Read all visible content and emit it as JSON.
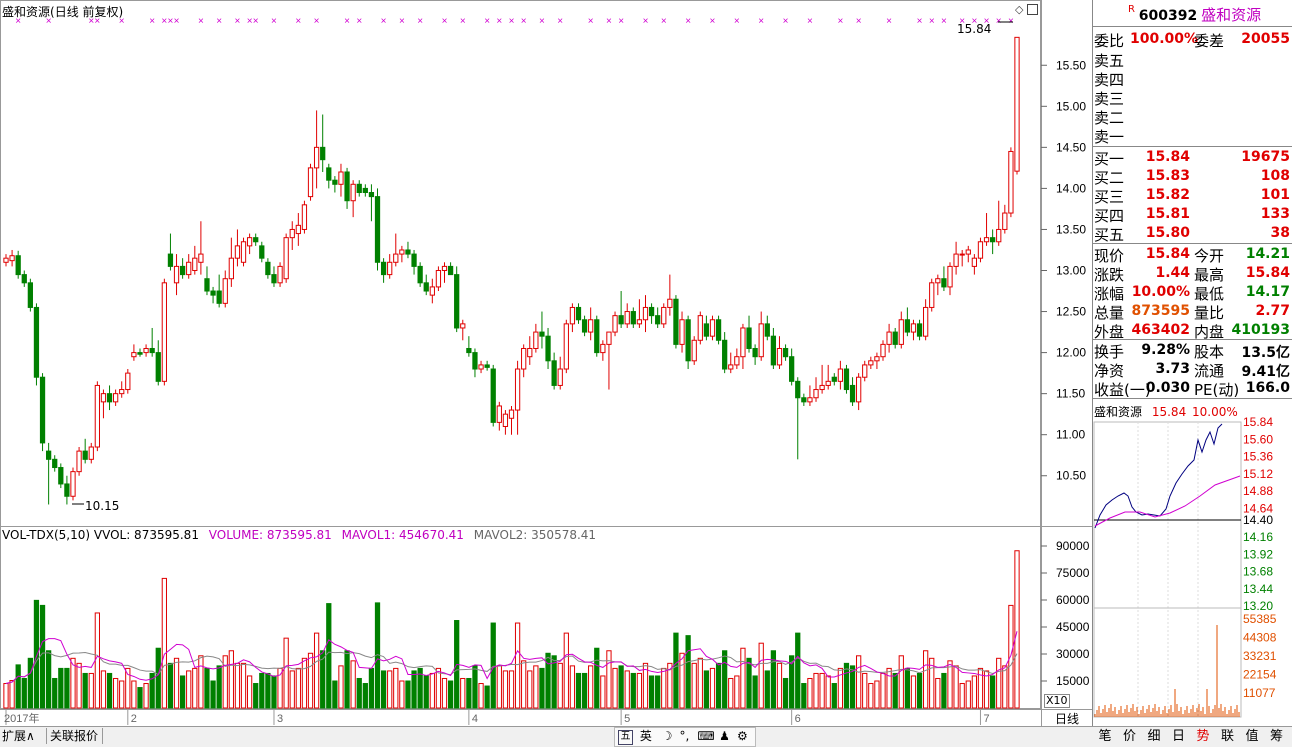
{
  "header": {
    "stock_name": "盛和资源",
    "period": "(日线 前复权)"
  },
  "chart_data": {
    "type": "candlestick",
    "ylim": [
      9.9,
      16.1
    ],
    "y_ticks": [
      "15.50",
      "15.00",
      "14.50",
      "14.00",
      "13.50",
      "13.00",
      "12.50",
      "12.00",
      "11.50",
      "11.00",
      "10.50"
    ],
    "high_label": "15.84",
    "low_label": "10.15",
    "months": [
      {
        "label": "2017年",
        "index": 0
      },
      {
        "label": "2",
        "index": 20
      },
      {
        "label": "3",
        "index": 44
      },
      {
        "label": "4",
        "index": 76
      },
      {
        "label": "5",
        "index": 101
      },
      {
        "label": "6",
        "index": 129
      },
      {
        "label": "7",
        "index": 160
      }
    ],
    "candles": [
      {
        "o": 13.1,
        "h": 13.2,
        "l": 13.05,
        "c": 13.15
      },
      {
        "o": 13.12,
        "h": 13.25,
        "l": 13.05,
        "c": 13.18
      },
      {
        "o": 13.18,
        "h": 13.24,
        "l": 12.9,
        "c": 12.95
      },
      {
        "o": 12.95,
        "h": 13.0,
        "l": 12.8,
        "c": 12.85
      },
      {
        "o": 12.85,
        "h": 12.9,
        "l": 12.5,
        "c": 12.55
      },
      {
        "o": 12.55,
        "h": 12.6,
        "l": 11.6,
        "c": 11.7
      },
      {
        "o": 11.7,
        "h": 11.75,
        "l": 10.8,
        "c": 10.9
      },
      {
        "o": 10.8,
        "h": 10.9,
        "l": 10.15,
        "c": 10.7
      },
      {
        "o": 10.7,
        "h": 10.75,
        "l": 10.55,
        "c": 10.6
      },
      {
        "o": 10.6,
        "h": 10.65,
        "l": 10.35,
        "c": 10.4
      },
      {
        "o": 10.4,
        "h": 10.5,
        "l": 10.15,
        "c": 10.25
      },
      {
        "o": 10.25,
        "h": 10.6,
        "l": 10.2,
        "c": 10.55
      },
      {
        "o": 10.55,
        "h": 10.85,
        "l": 10.5,
        "c": 10.8
      },
      {
        "o": 10.8,
        "h": 10.95,
        "l": 10.65,
        "c": 10.7
      },
      {
        "o": 10.7,
        "h": 10.9,
        "l": 10.65,
        "c": 10.85
      },
      {
        "o": 10.85,
        "h": 11.65,
        "l": 10.8,
        "c": 11.6
      },
      {
        "o": 11.4,
        "h": 11.55,
        "l": 11.2,
        "c": 11.5
      },
      {
        "o": 11.5,
        "h": 11.6,
        "l": 11.3,
        "c": 11.4
      },
      {
        "o": 11.4,
        "h": 11.55,
        "l": 11.35,
        "c": 11.5
      },
      {
        "o": 11.5,
        "h": 11.65,
        "l": 11.45,
        "c": 11.55
      },
      {
        "o": 11.55,
        "h": 11.8,
        "l": 11.5,
        "c": 11.75
      },
      {
        "o": 11.95,
        "h": 12.1,
        "l": 11.9,
        "c": 12.0
      },
      {
        "o": 12.0,
        "h": 12.05,
        "l": 11.95,
        "c": 11.98
      },
      {
        "o": 12.0,
        "h": 12.1,
        "l": 11.95,
        "c": 12.05
      },
      {
        "o": 12.05,
        "h": 12.3,
        "l": 11.95,
        "c": 12.0
      },
      {
        "o": 12.0,
        "h": 12.15,
        "l": 11.6,
        "c": 11.65
      },
      {
        "o": 11.65,
        "h": 12.9,
        "l": 11.6,
        "c": 12.85
      },
      {
        "o": 13.2,
        "h": 13.45,
        "l": 13.0,
        "c": 13.05
      },
      {
        "o": 12.85,
        "h": 13.2,
        "l": 12.7,
        "c": 13.05
      },
      {
        "o": 13.05,
        "h": 13.15,
        "l": 12.9,
        "c": 12.95
      },
      {
        "o": 12.95,
        "h": 13.2,
        "l": 12.9,
        "c": 13.1
      },
      {
        "o": 13.0,
        "h": 13.3,
        "l": 12.95,
        "c": 13.15
      },
      {
        "o": 13.1,
        "h": 13.6,
        "l": 12.95,
        "c": 13.2
      },
      {
        "o": 12.9,
        "h": 13.05,
        "l": 12.7,
        "c": 12.75
      },
      {
        "o": 12.75,
        "h": 12.8,
        "l": 12.6,
        "c": 12.7
      },
      {
        "o": 12.75,
        "h": 12.95,
        "l": 12.55,
        "c": 12.6
      },
      {
        "o": 12.6,
        "h": 13.0,
        "l": 12.55,
        "c": 12.9
      },
      {
        "o": 12.9,
        "h": 13.4,
        "l": 12.8,
        "c": 13.15
      },
      {
        "o": 13.15,
        "h": 13.5,
        "l": 13.05,
        "c": 13.3
      },
      {
        "o": 13.1,
        "h": 13.4,
        "l": 13.05,
        "c": 13.35
      },
      {
        "o": 13.3,
        "h": 13.45,
        "l": 13.2,
        "c": 13.4
      },
      {
        "o": 13.4,
        "h": 13.45,
        "l": 13.3,
        "c": 13.35
      },
      {
        "o": 13.3,
        "h": 13.35,
        "l": 13.1,
        "c": 13.15
      },
      {
        "o": 13.1,
        "h": 13.15,
        "l": 12.9,
        "c": 12.95
      },
      {
        "o": 12.95,
        "h": 13.05,
        "l": 12.8,
        "c": 12.85
      },
      {
        "o": 12.85,
        "h": 13.1,
        "l": 12.8,
        "c": 13.05
      },
      {
        "o": 12.9,
        "h": 13.45,
        "l": 12.85,
        "c": 13.4
      },
      {
        "o": 13.4,
        "h": 13.6,
        "l": 13.25,
        "c": 13.5
      },
      {
        "o": 13.45,
        "h": 13.7,
        "l": 13.3,
        "c": 13.55
      },
      {
        "o": 13.5,
        "h": 13.85,
        "l": 13.45,
        "c": 13.8
      },
      {
        "o": 13.9,
        "h": 14.3,
        "l": 13.85,
        "c": 14.25
      },
      {
        "o": 14.25,
        "h": 14.95,
        "l": 14.0,
        "c": 14.5
      },
      {
        "o": 14.5,
        "h": 14.9,
        "l": 14.2,
        "c": 14.35
      },
      {
        "o": 14.25,
        "h": 14.3,
        "l": 14.0,
        "c": 14.1
      },
      {
        "o": 14.1,
        "h": 14.15,
        "l": 13.95,
        "c": 14.05
      },
      {
        "o": 14.05,
        "h": 14.3,
        "l": 13.9,
        "c": 14.2
      },
      {
        "o": 14.2,
        "h": 14.25,
        "l": 13.75,
        "c": 13.85
      },
      {
        "o": 13.85,
        "h": 14.1,
        "l": 13.65,
        "c": 14.05
      },
      {
        "o": 14.05,
        "h": 14.1,
        "l": 13.9,
        "c": 13.95
      },
      {
        "o": 14.0,
        "h": 14.05,
        "l": 13.9,
        "c": 13.95
      },
      {
        "o": 13.95,
        "h": 14.05,
        "l": 13.6,
        "c": 13.9
      },
      {
        "o": 13.9,
        "h": 14.0,
        "l": 13.0,
        "c": 13.1
      },
      {
        "o": 13.1,
        "h": 13.15,
        "l": 12.85,
        "c": 12.95
      },
      {
        "o": 12.95,
        "h": 13.2,
        "l": 12.9,
        "c": 13.1
      },
      {
        "o": 13.1,
        "h": 13.45,
        "l": 13.05,
        "c": 13.2
      },
      {
        "o": 13.2,
        "h": 13.3,
        "l": 13.1,
        "c": 13.25
      },
      {
        "o": 13.25,
        "h": 13.35,
        "l": 13.15,
        "c": 13.2
      },
      {
        "o": 13.2,
        "h": 13.25,
        "l": 12.95,
        "c": 13.05
      },
      {
        "o": 13.05,
        "h": 13.1,
        "l": 12.8,
        "c": 12.85
      },
      {
        "o": 12.85,
        "h": 12.95,
        "l": 12.7,
        "c": 12.75
      },
      {
        "o": 12.7,
        "h": 12.9,
        "l": 12.6,
        "c": 12.8
      },
      {
        "o": 12.8,
        "h": 13.05,
        "l": 12.75,
        "c": 13.0
      },
      {
        "o": 13.0,
        "h": 13.1,
        "l": 12.85,
        "c": 13.05
      },
      {
        "o": 13.05,
        "h": 13.1,
        "l": 12.95,
        "c": 12.95
      },
      {
        "o": 12.95,
        "h": 13.05,
        "l": 12.25,
        "c": 12.3
      },
      {
        "o": 12.3,
        "h": 12.4,
        "l": 12.15,
        "c": 12.35
      },
      {
        "o": 12.05,
        "h": 12.2,
        "l": 11.95,
        "c": 12.0
      },
      {
        "o": 12.0,
        "h": 12.05,
        "l": 11.7,
        "c": 11.8
      },
      {
        "o": 11.8,
        "h": 11.9,
        "l": 11.75,
        "c": 11.85
      },
      {
        "o": 11.85,
        "h": 11.9,
        "l": 11.78,
        "c": 11.82
      },
      {
        "o": 11.8,
        "h": 11.85,
        "l": 11.1,
        "c": 11.15
      },
      {
        "o": 11.15,
        "h": 11.4,
        "l": 11.05,
        "c": 11.35
      },
      {
        "o": 11.1,
        "h": 11.3,
        "l": 11.0,
        "c": 11.25
      },
      {
        "o": 11.2,
        "h": 11.35,
        "l": 11.0,
        "c": 11.3
      },
      {
        "o": 11.3,
        "h": 11.9,
        "l": 11.0,
        "c": 11.8
      },
      {
        "o": 11.8,
        "h": 12.1,
        "l": 11.7,
        "c": 12.05
      },
      {
        "o": 11.95,
        "h": 12.2,
        "l": 11.85,
        "c": 12.05
      },
      {
        "o": 12.05,
        "h": 12.35,
        "l": 12.0,
        "c": 12.25
      },
      {
        "o": 12.25,
        "h": 12.5,
        "l": 12.05,
        "c": 12.2
      },
      {
        "o": 12.2,
        "h": 12.3,
        "l": 11.8,
        "c": 11.9
      },
      {
        "o": 11.9,
        "h": 12.0,
        "l": 11.55,
        "c": 11.6
      },
      {
        "o": 11.6,
        "h": 11.95,
        "l": 11.55,
        "c": 11.8
      },
      {
        "o": 11.8,
        "h": 12.4,
        "l": 11.75,
        "c": 12.35
      },
      {
        "o": 12.35,
        "h": 12.6,
        "l": 12.25,
        "c": 12.55
      },
      {
        "o": 12.55,
        "h": 12.6,
        "l": 12.35,
        "c": 12.4
      },
      {
        "o": 12.4,
        "h": 12.45,
        "l": 12.2,
        "c": 12.25
      },
      {
        "o": 12.25,
        "h": 12.55,
        "l": 12.15,
        "c": 12.4
      },
      {
        "o": 12.4,
        "h": 12.45,
        "l": 11.95,
        "c": 12.0
      },
      {
        "o": 12.0,
        "h": 12.15,
        "l": 11.9,
        "c": 12.1
      },
      {
        "o": 12.1,
        "h": 12.25,
        "l": 11.55,
        "c": 12.25
      },
      {
        "o": 12.25,
        "h": 12.5,
        "l": 12.2,
        "c": 12.45
      },
      {
        "o": 12.45,
        "h": 12.75,
        "l": 12.3,
        "c": 12.35
      },
      {
        "o": 12.35,
        "h": 12.6,
        "l": 12.3,
        "c": 12.5
      },
      {
        "o": 12.5,
        "h": 12.55,
        "l": 12.3,
        "c": 12.35
      },
      {
        "o": 12.35,
        "h": 12.65,
        "l": 12.3,
        "c": 12.4
      },
      {
        "o": 12.4,
        "h": 12.7,
        "l": 12.25,
        "c": 12.55
      },
      {
        "o": 12.55,
        "h": 12.6,
        "l": 12.35,
        "c": 12.45
      },
      {
        "o": 12.45,
        "h": 12.55,
        "l": 12.3,
        "c": 12.35
      },
      {
        "o": 12.35,
        "h": 12.6,
        "l": 12.3,
        "c": 12.55
      },
      {
        "o": 12.55,
        "h": 12.95,
        "l": 12.45,
        "c": 12.65
      },
      {
        "o": 12.65,
        "h": 12.7,
        "l": 12.05,
        "c": 12.1
      },
      {
        "o": 12.1,
        "h": 12.5,
        "l": 12.0,
        "c": 12.4
      },
      {
        "o": 12.4,
        "h": 12.45,
        "l": 11.8,
        "c": 11.9
      },
      {
        "o": 11.9,
        "h": 12.2,
        "l": 11.85,
        "c": 12.15
      },
      {
        "o": 12.15,
        "h": 12.5,
        "l": 12.1,
        "c": 12.45
      },
      {
        "o": 12.35,
        "h": 12.45,
        "l": 12.15,
        "c": 12.2
      },
      {
        "o": 12.2,
        "h": 12.45,
        "l": 12.15,
        "c": 12.4
      },
      {
        "o": 12.4,
        "h": 12.45,
        "l": 12.1,
        "c": 12.15
      },
      {
        "o": 12.15,
        "h": 12.25,
        "l": 11.75,
        "c": 11.8
      },
      {
        "o": 11.8,
        "h": 12.0,
        "l": 11.75,
        "c": 11.85
      },
      {
        "o": 11.85,
        "h": 12.05,
        "l": 11.8,
        "c": 11.95
      },
      {
        "o": 11.95,
        "h": 12.35,
        "l": 11.8,
        "c": 12.3
      },
      {
        "o": 12.3,
        "h": 12.45,
        "l": 12.0,
        "c": 12.05
      },
      {
        "o": 12.05,
        "h": 12.1,
        "l": 11.85,
        "c": 11.95
      },
      {
        "o": 11.95,
        "h": 12.5,
        "l": 11.9,
        "c": 12.35
      },
      {
        "o": 12.35,
        "h": 12.45,
        "l": 12.15,
        "c": 12.2
      },
      {
        "o": 12.2,
        "h": 12.3,
        "l": 11.8,
        "c": 11.85
      },
      {
        "o": 11.85,
        "h": 12.2,
        "l": 11.8,
        "c": 12.05
      },
      {
        "o": 12.05,
        "h": 12.1,
        "l": 11.9,
        "c": 11.95
      },
      {
        "o": 11.95,
        "h": 12.05,
        "l": 11.6,
        "c": 11.65
      },
      {
        "o": 11.65,
        "h": 11.7,
        "l": 10.7,
        "c": 11.45
      },
      {
        "o": 11.45,
        "h": 11.5,
        "l": 11.35,
        "c": 11.4
      },
      {
        "o": 11.4,
        "h": 11.6,
        "l": 11.35,
        "c": 11.45
      },
      {
        "o": 11.45,
        "h": 11.7,
        "l": 11.4,
        "c": 11.55
      },
      {
        "o": 11.55,
        "h": 11.85,
        "l": 11.5,
        "c": 11.6
      },
      {
        "o": 11.6,
        "h": 11.85,
        "l": 11.55,
        "c": 11.65
      },
      {
        "o": 11.7,
        "h": 11.75,
        "l": 11.6,
        "c": 11.65
      },
      {
        "o": 11.65,
        "h": 11.9,
        "l": 11.55,
        "c": 11.8
      },
      {
        "o": 11.8,
        "h": 11.85,
        "l": 11.5,
        "c": 11.55
      },
      {
        "o": 11.6,
        "h": 11.7,
        "l": 11.35,
        "c": 11.4
      },
      {
        "o": 11.4,
        "h": 11.75,
        "l": 11.3,
        "c": 11.7
      },
      {
        "o": 11.7,
        "h": 11.9,
        "l": 11.65,
        "c": 11.85
      },
      {
        "o": 11.85,
        "h": 11.95,
        "l": 11.8,
        "c": 11.9
      },
      {
        "o": 11.9,
        "h": 12.0,
        "l": 11.8,
        "c": 11.95
      },
      {
        "o": 11.95,
        "h": 12.15,
        "l": 11.9,
        "c": 12.1
      },
      {
        "o": 12.1,
        "h": 12.35,
        "l": 12.0,
        "c": 12.25
      },
      {
        "o": 12.25,
        "h": 12.3,
        "l": 12.05,
        "c": 12.1
      },
      {
        "o": 12.1,
        "h": 12.5,
        "l": 12.05,
        "c": 12.4
      },
      {
        "o": 12.4,
        "h": 12.55,
        "l": 12.2,
        "c": 12.25
      },
      {
        "o": 12.25,
        "h": 12.4,
        "l": 12.15,
        "c": 12.35
      },
      {
        "o": 12.35,
        "h": 12.4,
        "l": 12.15,
        "c": 12.2
      },
      {
        "o": 12.2,
        "h": 12.65,
        "l": 12.15,
        "c": 12.55
      },
      {
        "o": 12.55,
        "h": 12.9,
        "l": 12.5,
        "c": 12.85
      },
      {
        "o": 12.85,
        "h": 12.95,
        "l": 12.7,
        "c": 12.9
      },
      {
        "o": 12.9,
        "h": 13.05,
        "l": 12.75,
        "c": 12.8
      },
      {
        "o": 12.8,
        "h": 13.1,
        "l": 12.7,
        "c": 13.05
      },
      {
        "o": 13.05,
        "h": 13.35,
        "l": 12.95,
        "c": 13.2
      },
      {
        "o": 13.2,
        "h": 13.25,
        "l": 13.05,
        "c": 13.2
      },
      {
        "o": 13.2,
        "h": 13.3,
        "l": 13.1,
        "c": 13.25
      },
      {
        "o": 13.05,
        "h": 13.2,
        "l": 12.95,
        "c": 13.15
      },
      {
        "o": 13.15,
        "h": 13.4,
        "l": 13.1,
        "c": 13.35
      },
      {
        "o": 13.35,
        "h": 13.7,
        "l": 13.3,
        "c": 13.4
      },
      {
        "o": 13.4,
        "h": 13.5,
        "l": 13.2,
        "c": 13.35
      },
      {
        "o": 13.35,
        "h": 13.85,
        "l": 13.3,
        "c": 13.5
      },
      {
        "o": 13.5,
        "h": 13.8,
        "l": 13.45,
        "c": 13.7
      },
      {
        "o": 13.7,
        "h": 14.5,
        "l": 13.65,
        "c": 14.45
      },
      {
        "o": 14.21,
        "h": 15.84,
        "l": 14.17,
        "c": 15.84
      }
    ]
  },
  "volume": {
    "title_label": "VOL-TDX(5,10)",
    "vvol_label": "VVOL: 873595.81",
    "volume_label": "VOLUME: 873595.81",
    "mavol1_label": "MAVOL1: 454670.41",
    "mavol2_label": "MAVOL2: 350578.41",
    "y_ticks": [
      "90000",
      "75000",
      "60000",
      "45000",
      "30000",
      "15000"
    ],
    "unit_label": "X10",
    "ymax": 100000
  },
  "quote": {
    "r_badge": "R",
    "code": "600392",
    "name": "盛和资源",
    "rows_top": [
      {
        "l1": "委比",
        "v1": "100.00%",
        "l2": "委差",
        "v2": "20055"
      }
    ],
    "asks": [
      "卖五",
      "卖四",
      "卖三",
      "卖二",
      "卖一"
    ],
    "bids": [
      {
        "label": "买一",
        "price": "15.84",
        "vol": "19675"
      },
      {
        "label": "买二",
        "price": "15.83",
        "vol": "108"
      },
      {
        "label": "买三",
        "price": "15.82",
        "vol": "101"
      },
      {
        "label": "买四",
        "price": "15.81",
        "vol": "133"
      },
      {
        "label": "买五",
        "price": "15.80",
        "vol": "38"
      }
    ],
    "stats": [
      {
        "l1": "现价",
        "v1": "15.84",
        "c1": "red",
        "l2": "今开",
        "v2": "14.21",
        "c2": "green"
      },
      {
        "l1": "涨跌",
        "v1": "1.44",
        "c1": "red",
        "l2": "最高",
        "v2": "15.84",
        "c2": "red"
      },
      {
        "l1": "涨幅",
        "v1": "10.00%",
        "c1": "red",
        "l2": "最低",
        "v2": "14.17",
        "c2": "green"
      },
      {
        "l1": "总量",
        "v1": "873595",
        "c1": "orange",
        "l2": "量比",
        "v2": "2.77",
        "c2": "red"
      },
      {
        "l1": "外盘",
        "v1": "463402",
        "c1": "red",
        "l2": "内盘",
        "v2": "410193",
        "c2": "green"
      }
    ],
    "fund": [
      {
        "l1": "换手",
        "v1": "9.28%",
        "l2": "股本",
        "v2": "13.5亿"
      },
      {
        "l1": "净资",
        "v1": "3.73",
        "l2": "流通",
        "v2": "9.41亿"
      },
      {
        "l1": "收益(一)",
        "v1": "0.030",
        "l2": "PE(动)",
        "v2": "166.0"
      }
    ]
  },
  "intraday": {
    "name": "盛和资源",
    "price": "15.84",
    "pct": "10.00%",
    "price_ticks_red": [
      "15.84",
      "15.60",
      "15.36",
      "15.12",
      "14.88",
      "14.64"
    ],
    "price_mid": "14.40",
    "price_ticks_green": [
      "14.16",
      "13.92",
      "13.68",
      "13.44",
      "13.20"
    ],
    "vol_ticks": [
      "55385",
      "44308",
      "33231",
      "22154",
      "11077"
    ]
  },
  "bottom_tabs": [
    "扩展∧",
    "关联报价"
  ],
  "ime_items": [
    "英"
  ],
  "right_tabs": [
    "笔",
    "价",
    "细",
    "日",
    "势",
    "联",
    "值",
    "筹"
  ],
  "period_tab": "日线"
}
